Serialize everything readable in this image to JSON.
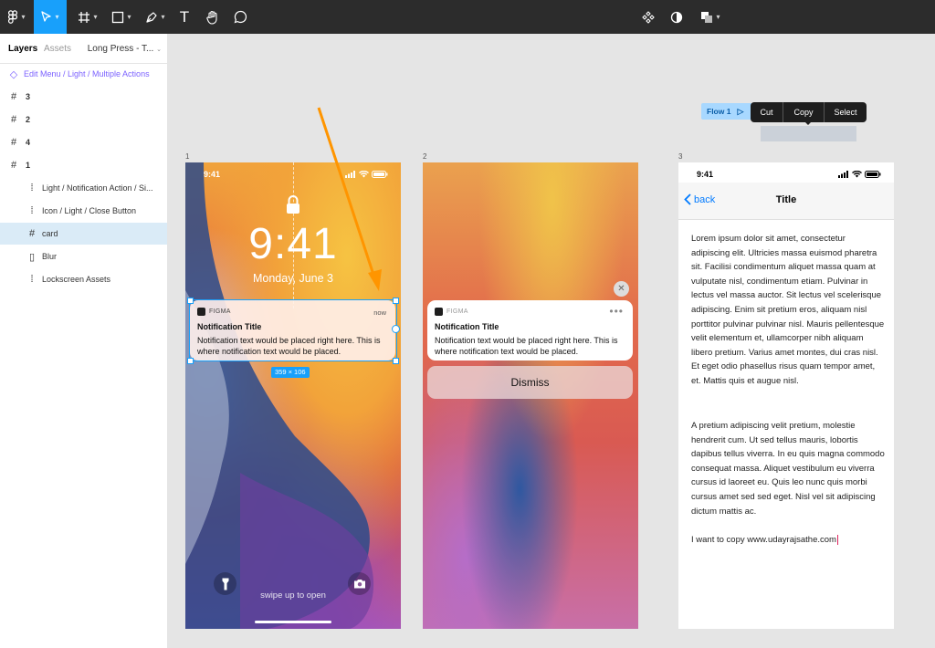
{
  "toolbar": {
    "left_icons": [
      "figma-menu-icon",
      "move-tool-icon",
      "frame-tool-icon",
      "shape-tool-icon",
      "pen-tool-icon",
      "text-tool-icon",
      "hand-tool-icon",
      "comment-tool-icon"
    ],
    "text_tool_glyph": "T",
    "center_icons": [
      "component-icon",
      "mask-icon",
      "boolean-icon"
    ]
  },
  "sidebar": {
    "tabs": [
      "Layers",
      "Assets"
    ],
    "page_selector": "Long Press - T...",
    "layers": [
      {
        "label": "Edit Menu / Light / Multiple Actions",
        "type": "component"
      },
      {
        "label": "3",
        "type": "frame"
      },
      {
        "label": "2",
        "type": "frame"
      },
      {
        "label": "4",
        "type": "frame"
      },
      {
        "label": "1",
        "type": "frame"
      },
      {
        "label": "Light / Notification Action / Si...",
        "type": "instance"
      },
      {
        "label": "Icon / Light / Close Button",
        "type": "instance"
      },
      {
        "label": "card",
        "type": "frame",
        "selected": true
      },
      {
        "label": "Blur",
        "type": "rect"
      },
      {
        "label": "Lockscreen Assets",
        "type": "instance"
      }
    ]
  },
  "canvas": {
    "frame_labels": [
      "1",
      "2",
      "3"
    ],
    "flow_label": "Flow 1",
    "edit_menu": [
      "Cut",
      "Copy",
      "Select"
    ],
    "phone1": {
      "time": "9:41",
      "clock": "9:41",
      "date": "Monday, June 3",
      "app_name": "FIGMA",
      "notif_time": "now",
      "notif_title": "Notification Title",
      "notif_body": "Notification text would be placed right here. This is where notification text would be placed.",
      "size_badge": "359 × 106",
      "swipe": "swipe up to open"
    },
    "phone2": {
      "app_name": "FIGMA",
      "notif_title": "Notification Title",
      "notif_body": "Notification text would be placed right here. This is where notification text would be placed.",
      "dismiss": "Dismiss"
    },
    "phone3": {
      "time": "9:41",
      "back": "back",
      "title": "Title",
      "para1": "Lorem ipsum dolor sit amet, consectetur adipiscing elit. Ultricies massa euismod pharetra sit. Facilisi condimentum aliquet massa quam at vulputate nisl, condimentum etiam. Pulvinar in lectus vel massa auctor. Sit lectus vel scelerisque adipiscing. Enim sit pretium eros, aliquam nisl porttitor pulvinar pulvinar nisl. Mauris pellentesque velit elementum et, ullamcorper nibh aliquam libero pretium. Varius amet montes, dui cras nisl. Et eget odio phasellus risus quam tempor amet, et. Mattis quis et augue nisl.",
      "para2": "A pretium adipiscing velit pretium, molestie hendrerit cum. Ut sed tellus mauris, lobortis dapibus tellus viverra. In eu quis magna commodo consequat massa. Aliquet vestibulum eu viverra cursus id laoreet eu. Quis leo nunc quis morbi cursus amet sed sed eget. Nisl vel sit adipiscing dictum mattis ac.",
      "para3": "I want to copy www.udayrajsathe.com"
    }
  },
  "colors": {
    "selection": "#18a0fb",
    "annotation_arrow": "#ff9500",
    "component": "#7b61ff",
    "ios_blue": "#007aff"
  }
}
